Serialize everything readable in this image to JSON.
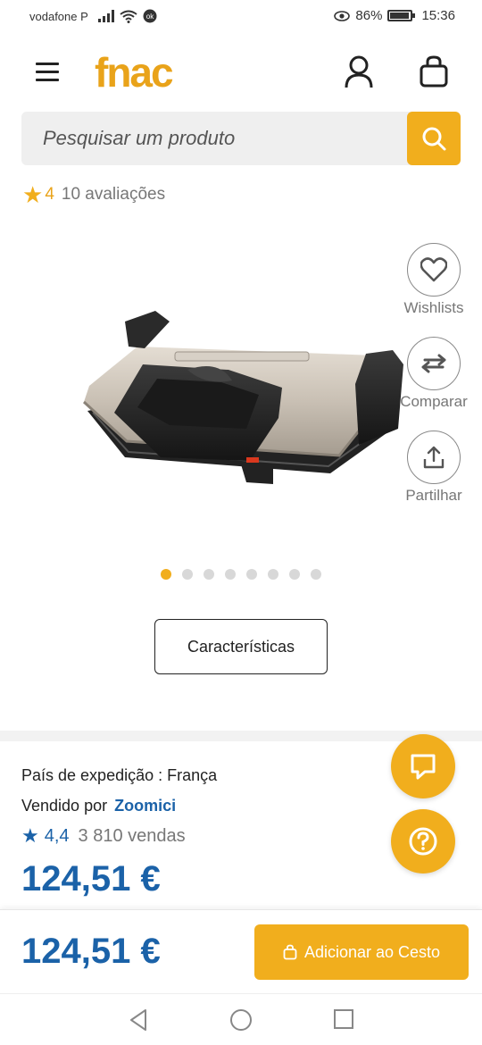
{
  "status_bar": {
    "carrier": "vodafone P",
    "battery": "86%",
    "time": "15:36"
  },
  "header": {
    "logo": "fnac"
  },
  "search": {
    "placeholder": "Pesquisar um produto"
  },
  "rating": {
    "value": "4",
    "count": "10 avaliações"
  },
  "side_actions": {
    "wishlists": "Wishlists",
    "compare": "Comparar",
    "share": "Partilhar"
  },
  "gallery": {
    "total_images": 8,
    "active_index": 0
  },
  "characteristics_button": "Características",
  "seller": {
    "shipping_country": "País de expedição : França",
    "sold_by_label": "Vendido por",
    "name": "Zoomici",
    "rating": "4,4",
    "sales": "3 810 vendas"
  },
  "price": "124,51 €",
  "buy_bar": {
    "price": "124,51 €",
    "add_to_cart": "Adicionar ao Cesto"
  },
  "colors": {
    "accent": "#f1ae1d",
    "brand_blue": "#1b62a8"
  }
}
